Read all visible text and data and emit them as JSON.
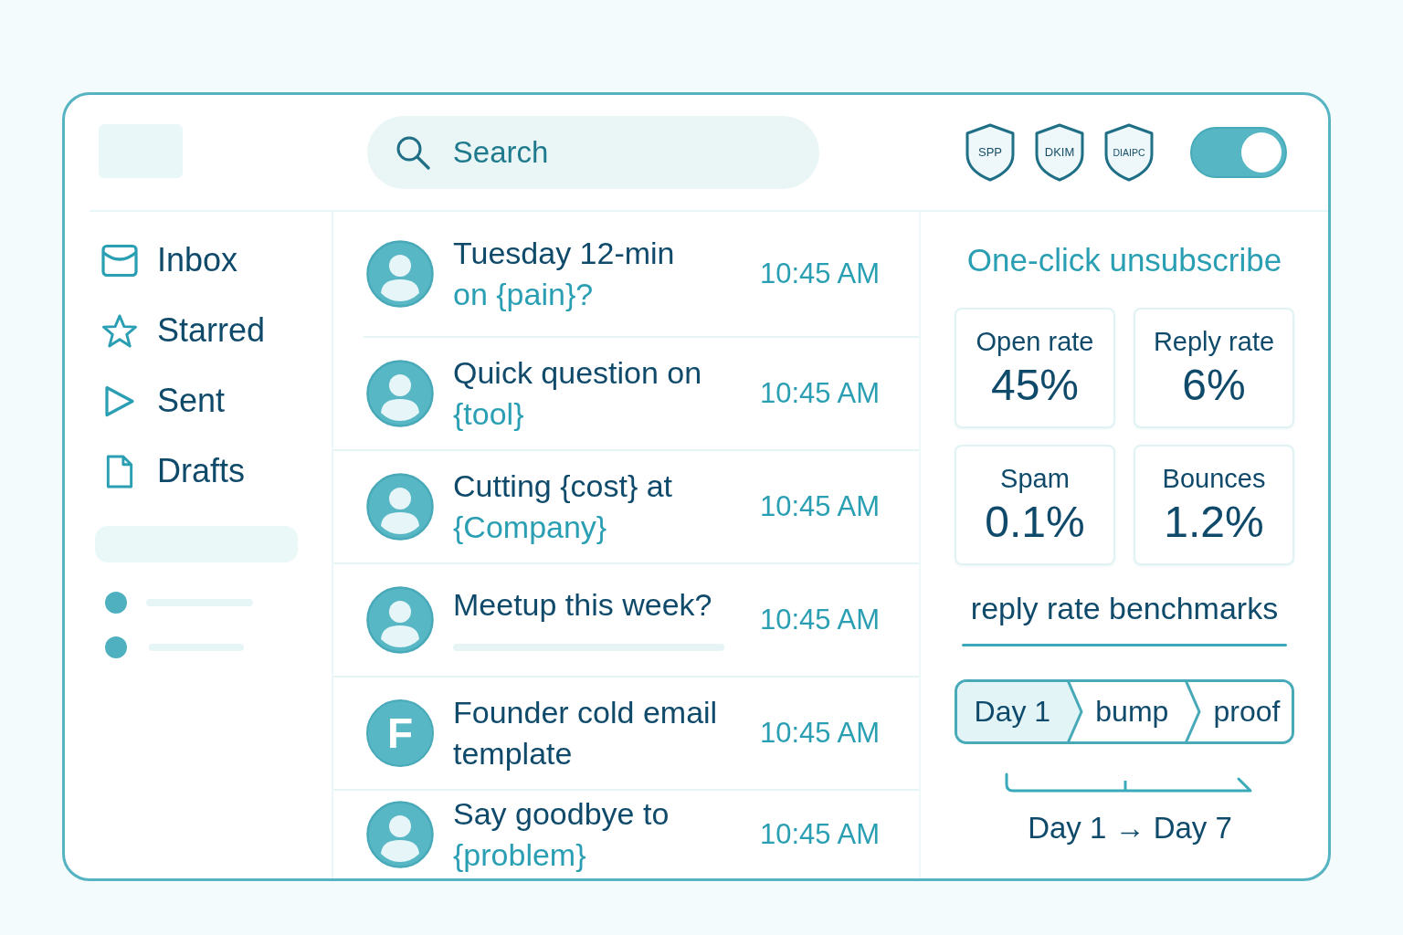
{
  "header": {
    "search": {
      "placeholder": "Search"
    },
    "badges": [
      "SPP",
      "DKIM",
      "DIAIPC"
    ],
    "toggle": {
      "on": true
    }
  },
  "sidebar": {
    "items": [
      {
        "label": "Inbox"
      },
      {
        "label": "Starred"
      },
      {
        "label": "Sent"
      },
      {
        "label": "Drafts"
      }
    ]
  },
  "messages": [
    {
      "avatar": {
        "kind": "person"
      },
      "lines": [
        {
          "kind": "subject",
          "text": "Tuesday 12-min"
        },
        {
          "kind": "variable",
          "text": "on {pain}?"
        }
      ],
      "time": "10:45 AM"
    },
    {
      "avatar": {
        "kind": "person"
      },
      "lines": [
        {
          "kind": "subject",
          "text": "Quick question on"
        },
        {
          "kind": "variable",
          "text": "{tool}"
        }
      ],
      "time": "10:45 AM"
    },
    {
      "avatar": {
        "kind": "person"
      },
      "lines": [
        {
          "kind": "subject",
          "text": "Cutting {cost} at"
        },
        {
          "kind": "variable",
          "text": "{Company}"
        }
      ],
      "time": "10:45 AM"
    },
    {
      "avatar": {
        "kind": "person"
      },
      "lines": [
        {
          "kind": "subject",
          "text": "Meetup this week?"
        },
        {
          "kind": "skeleton"
        }
      ],
      "time": "10:45 AM"
    },
    {
      "avatar": {
        "kind": "initial",
        "text": "F"
      },
      "lines": [
        {
          "kind": "subject",
          "text": "Founder cold email template"
        }
      ],
      "time": "10:45 AM"
    },
    {
      "avatar": {
        "kind": "person"
      },
      "lines": [
        {
          "kind": "subject",
          "text": "Say goodbye to"
        },
        {
          "kind": "variable",
          "text": "{problem}"
        }
      ],
      "time": "10:45 AM"
    }
  ],
  "panel": {
    "unsubscribe": "One-click unsubscribe",
    "stats": [
      {
        "label": "Open rate",
        "value": "45%"
      },
      {
        "label": "Reply rate",
        "value": "6%"
      },
      {
        "label": "Spam",
        "value": "0.1%"
      },
      {
        "label": "Bounces",
        "value": "1.2%"
      }
    ],
    "benchmarks_heading": "reply rate benchmarks",
    "sequence": [
      {
        "label": "Day 1",
        "selected": true
      },
      {
        "label": "bump",
        "selected": false
      },
      {
        "label": "proof",
        "selected": false
      }
    ],
    "timeline_caption": "Day 1 → Day 7"
  }
}
